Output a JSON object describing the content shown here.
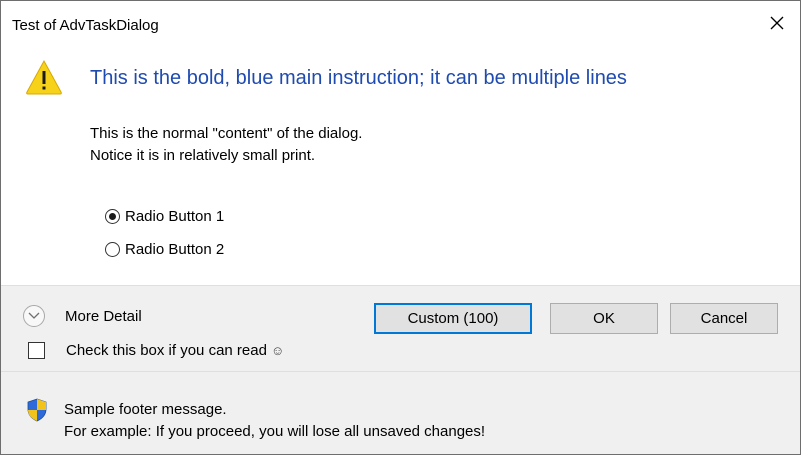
{
  "window": {
    "title": "Test of AdvTaskDialog",
    "close_glyph": "×"
  },
  "main": {
    "icon": "warning-icon",
    "instruction": "This is the bold, blue main instruction; it can be multiple lines",
    "content_lines": [
      "This is the normal \"content\" of the dialog.",
      "Notice it is in relatively small print."
    ],
    "radios": [
      {
        "label": "Radio Button 1",
        "selected": true
      },
      {
        "label": "Radio Button 2",
        "selected": false
      }
    ]
  },
  "buttons": {
    "expando_label": "More Detail",
    "checkbox_label": "Check this box if you can read",
    "checkbox_checked": false,
    "custom_label": "Custom (100)",
    "ok_label": "OK",
    "cancel_label": "Cancel"
  },
  "footer": {
    "icon": "shield-icon",
    "lines": [
      "Sample footer message.",
      "For example: If you proceed, you will lose all unsaved changes!"
    ]
  },
  "colors": {
    "instruction_blue": "#1f4bb0",
    "default_button_border": "#0078d7",
    "panel_gray": "#f0f0f0"
  }
}
